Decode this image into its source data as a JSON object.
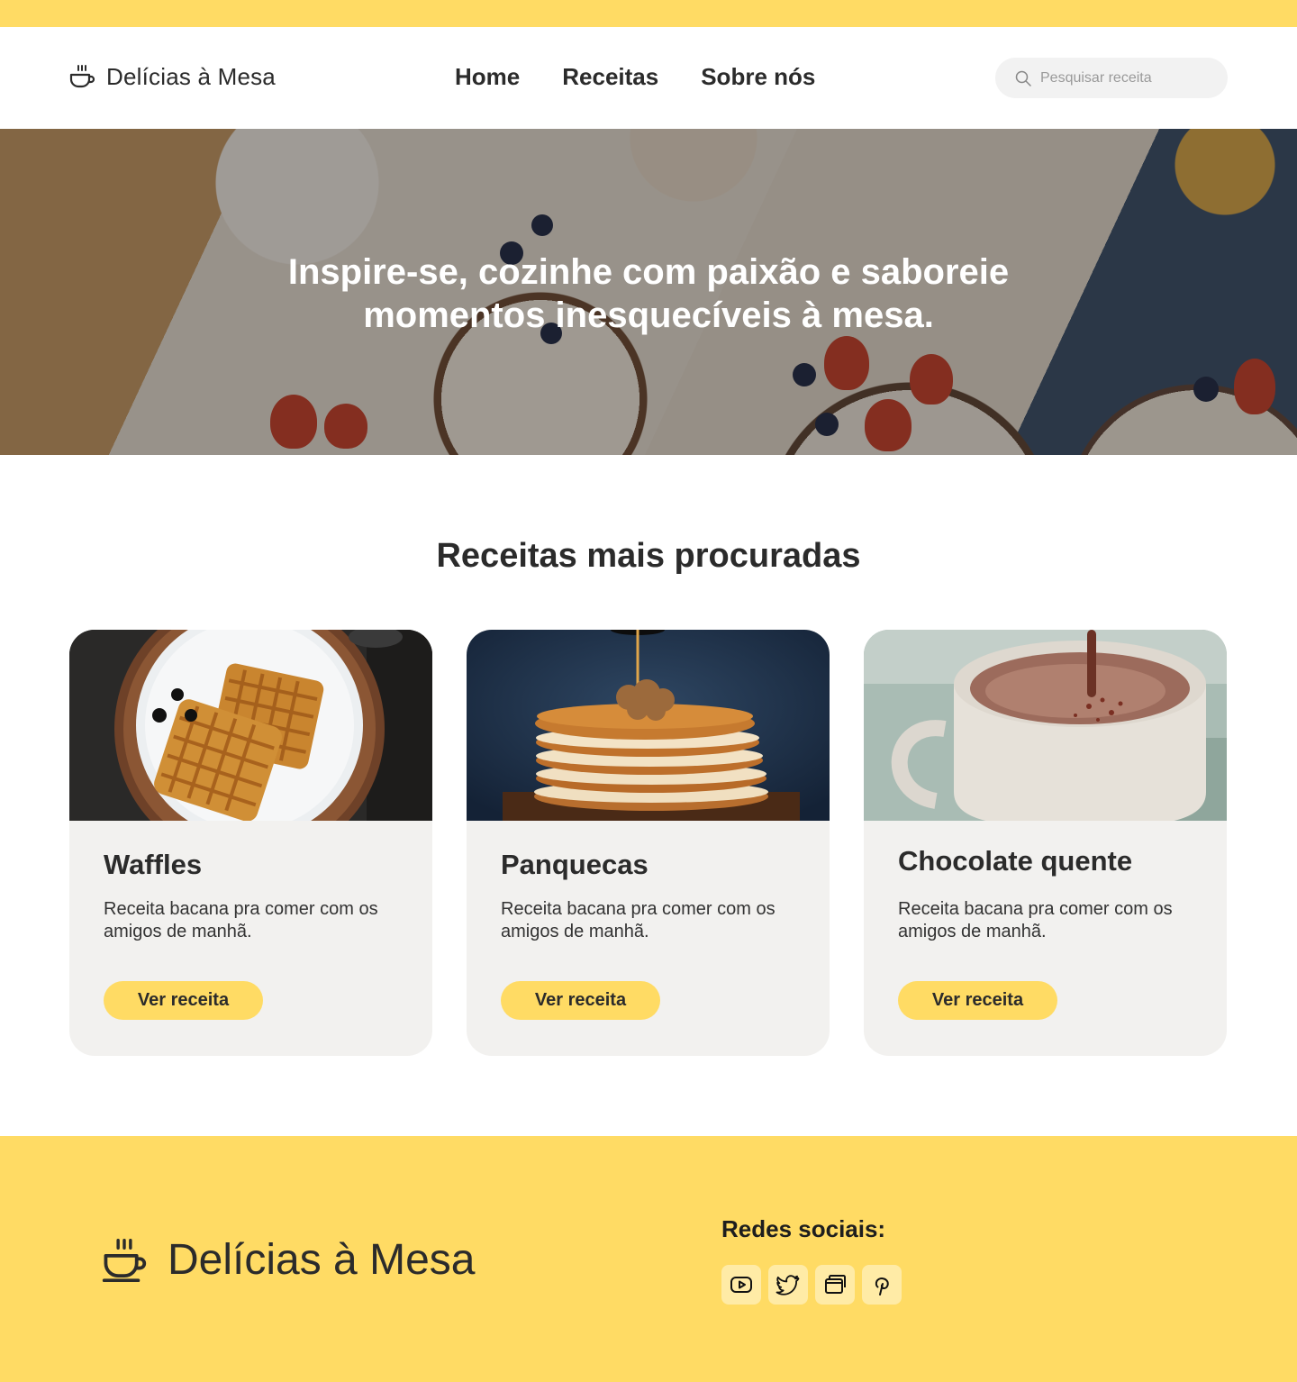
{
  "brand": {
    "name": "Delícias à Mesa"
  },
  "nav": {
    "items": [
      {
        "label": "Home"
      },
      {
        "label": "Receitas"
      },
      {
        "label": "Sobre nós"
      }
    ]
  },
  "search": {
    "placeholder": "Pesquisar receita",
    "value": ""
  },
  "hero": {
    "title": "Inspire-se, cozinhe com paixão e saboreie momentos inesquecíveis à mesa."
  },
  "section": {
    "title": "Receitas mais procuradas"
  },
  "cards": [
    {
      "title": "Waffles",
      "description": "Receita bacana pra comer com os amigos de manhã.",
      "button": "Ver receita",
      "image": "waffles-photo"
    },
    {
      "title": "Panquecas",
      "description": "Receita bacana pra comer com os amigos de manhã.",
      "button": "Ver receita",
      "image": "pancakes-photo"
    },
    {
      "title": "Chocolate quente",
      "description": "Receita bacana pra comer com os amigos de manhã.",
      "button": "Ver receita",
      "image": "hot-chocolate-photo"
    }
  ],
  "footer": {
    "brand": "Delícias à Mesa",
    "social_title": "Redes sociais:",
    "social": [
      {
        "icon": "youtube-icon"
      },
      {
        "icon": "twitter-icon"
      },
      {
        "icon": "browser-icon"
      },
      {
        "icon": "pinterest-icon"
      }
    ]
  },
  "colors": {
    "accent": "#FFDB64",
    "card_bg": "#F2F1EF",
    "text": "#2B2B2B",
    "social_bg": "#FFEBA6"
  }
}
